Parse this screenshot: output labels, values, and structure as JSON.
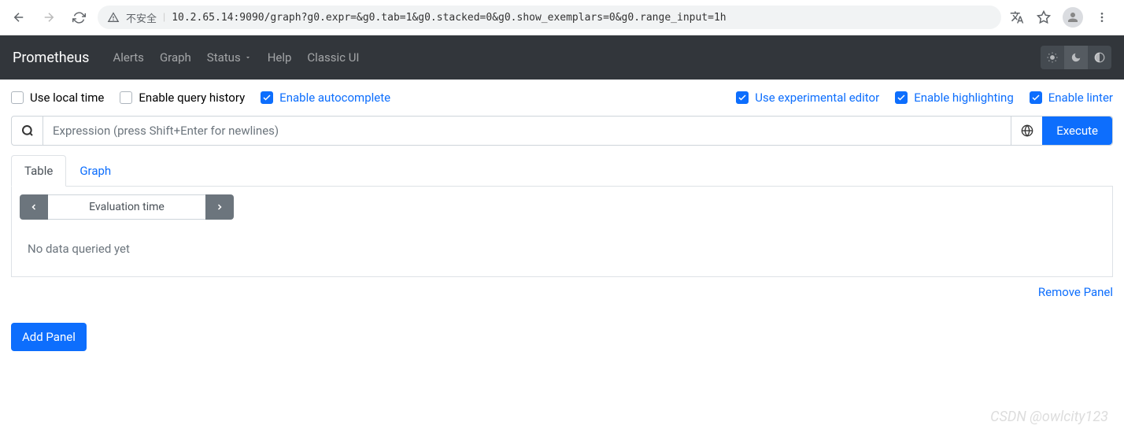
{
  "browser": {
    "insecure_label": "不安全",
    "url": "10.2.65.14:9090/graph?g0.expr=&g0.tab=1&g0.stacked=0&g0.show_exemplars=0&g0.range_input=1h"
  },
  "navbar": {
    "brand": "Prometheus",
    "links": {
      "alerts": "Alerts",
      "graph": "Graph",
      "status": "Status",
      "help": "Help",
      "classic": "Classic UI"
    }
  },
  "options": {
    "local_time": "Use local time",
    "query_history": "Enable query history",
    "autocomplete": "Enable autocomplete",
    "experimental": "Use experimental editor",
    "highlighting": "Enable highlighting",
    "linter": "Enable linter"
  },
  "expr": {
    "placeholder": "Expression (press Shift+Enter for newlines)",
    "execute": "Execute"
  },
  "tabs": {
    "table": "Table",
    "graph": "Graph"
  },
  "panel": {
    "eval_time": "Evaluation time",
    "no_data": "No data queried yet",
    "remove": "Remove Panel",
    "add": "Add Panel"
  },
  "watermark": "CSDN @owlcity123"
}
